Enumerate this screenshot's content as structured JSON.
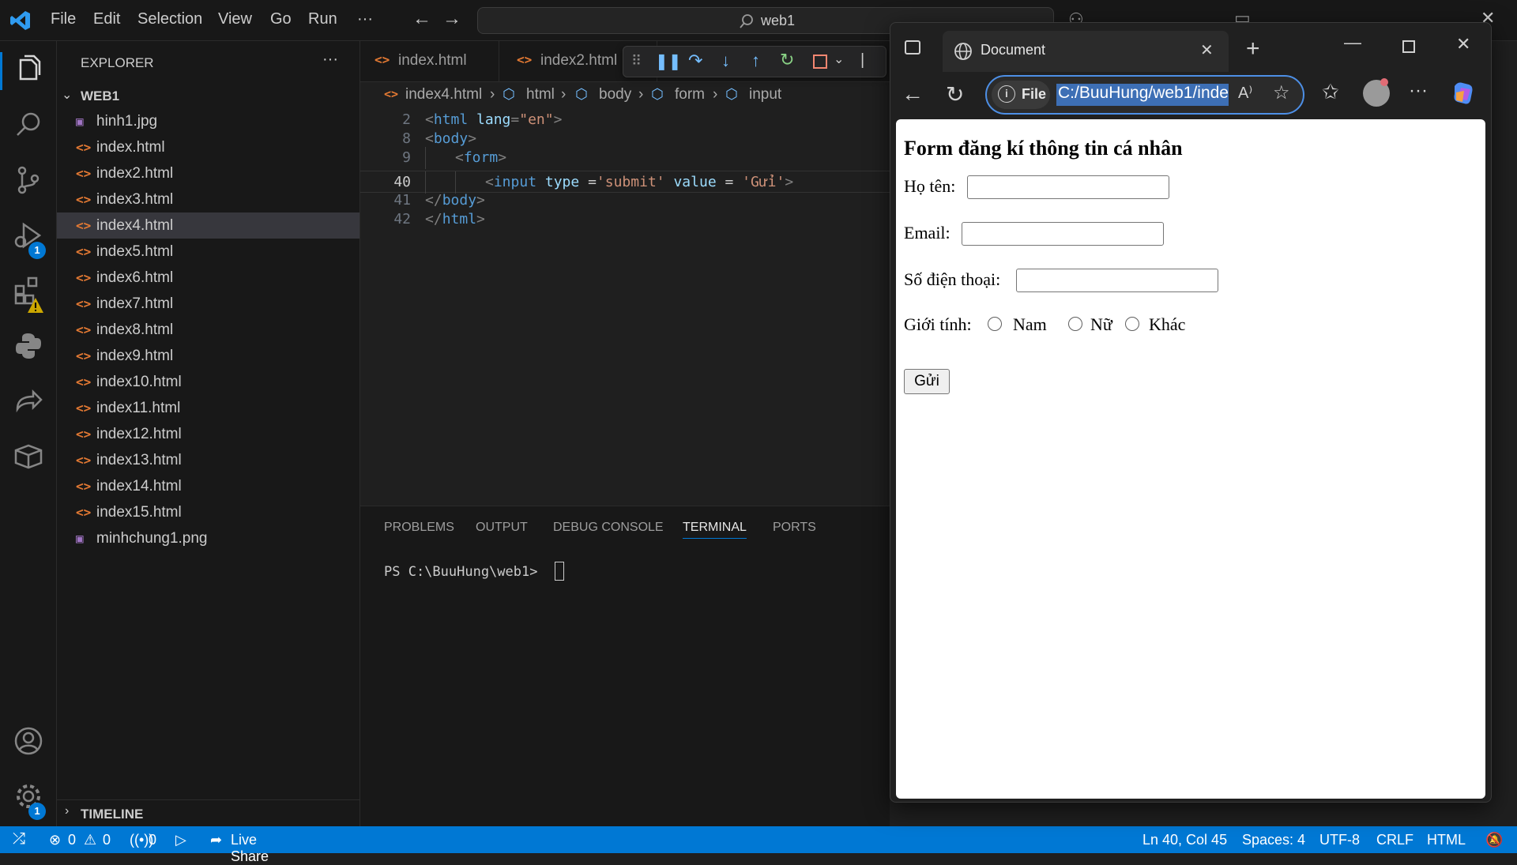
{
  "titlebar": {
    "menu": [
      "File",
      "Edit",
      "Selection",
      "View",
      "Go",
      "Run"
    ],
    "more": "···",
    "search": "web1"
  },
  "activity": {
    "debug_badge": "1",
    "settings_badge": "1"
  },
  "sidebar": {
    "title": "EXPLORER",
    "more": "···",
    "folder": "WEB1",
    "files": [
      {
        "name": "hinh1.jpg",
        "type": "image"
      },
      {
        "name": "index.html",
        "type": "html"
      },
      {
        "name": "index2.html",
        "type": "html"
      },
      {
        "name": "index3.html",
        "type": "html"
      },
      {
        "name": "index4.html",
        "type": "html"
      },
      {
        "name": "index5.html",
        "type": "html"
      },
      {
        "name": "index6.html",
        "type": "html"
      },
      {
        "name": "index7.html",
        "type": "html"
      },
      {
        "name": "index8.html",
        "type": "html"
      },
      {
        "name": "index9.html",
        "type": "html"
      },
      {
        "name": "index10.html",
        "type": "html"
      },
      {
        "name": "index11.html",
        "type": "html"
      },
      {
        "name": "index12.html",
        "type": "html"
      },
      {
        "name": "index13.html",
        "type": "html"
      },
      {
        "name": "index14.html",
        "type": "html"
      },
      {
        "name": "index15.html",
        "type": "html"
      },
      {
        "name": "minhchung1.png",
        "type": "image"
      }
    ],
    "timeline": "TIMELINE"
  },
  "editor": {
    "tabs": [
      "index.html",
      "index2.html"
    ],
    "breadcrumb": [
      "index4.html",
      "html",
      "body",
      "form",
      "input"
    ],
    "lines": [
      {
        "num": "2",
        "indent": 0,
        "parts": [
          [
            "punc",
            "<"
          ],
          [
            "tag",
            "html"
          ],
          [
            "plain",
            " "
          ],
          [
            "attr",
            "lang"
          ],
          [
            "punc",
            "="
          ],
          [
            "str",
            "\"en\""
          ],
          [
            "punc",
            ">"
          ]
        ]
      },
      {
        "num": "8",
        "indent": 0,
        "parts": [
          [
            "punc",
            "<"
          ],
          [
            "tag",
            "body"
          ],
          [
            "punc",
            ">"
          ]
        ]
      },
      {
        "num": "9",
        "indent": 1,
        "parts": [
          [
            "punc",
            "<"
          ],
          [
            "tag",
            "form"
          ],
          [
            "punc",
            ">"
          ]
        ]
      },
      {
        "num": "40",
        "indent": 2,
        "parts": [
          [
            "punc",
            "<"
          ],
          [
            "tag",
            "input"
          ],
          [
            "plain",
            " "
          ],
          [
            "attr",
            "type"
          ],
          [
            "plain",
            " ="
          ],
          [
            "str",
            "'submit'"
          ],
          [
            "plain",
            " "
          ],
          [
            "attr",
            "value"
          ],
          [
            "plain",
            " = "
          ],
          [
            "str",
            "'Gửi'"
          ],
          [
            "punc",
            ">"
          ]
        ]
      },
      {
        "num": "41",
        "indent": 0,
        "parts": [
          [
            "punc",
            "</"
          ],
          [
            "tag",
            "body"
          ],
          [
            "punc",
            ">"
          ]
        ]
      },
      {
        "num": "42",
        "indent": 0,
        "parts": [
          [
            "punc",
            "</"
          ],
          [
            "tag",
            "html"
          ],
          [
            "punc",
            ">"
          ]
        ]
      }
    ],
    "current_line": "40"
  },
  "panel": {
    "tabs": [
      "PROBLEMS",
      "OUTPUT",
      "DEBUG CONSOLE",
      "TERMINAL",
      "PORTS"
    ],
    "active_tab": "TERMINAL",
    "prompt": "PS C:\\BuuHung\\web1>"
  },
  "statusbar": {
    "errors": "0",
    "warnings": "0",
    "ports": "0",
    "live_share": "Live Share",
    "position": "Ln 40, Col 45",
    "spaces": "Spaces: 4",
    "encoding": "UTF-8",
    "eol": "CRLF",
    "language": "HTML"
  },
  "browser": {
    "tab_title": "Document",
    "file_chip": "File",
    "url": "C:/BuuHung/web1/inde",
    "page": {
      "heading": "Form đăng kí thông tin cá nhân",
      "name_label": "Họ tên:",
      "email_label": "Email:",
      "phone_label": "Số điện thoại:",
      "gender_label": "Giới tính:",
      "gender_options": [
        "Nam",
        "Nữ",
        "Khác"
      ],
      "submit": "Gửi"
    }
  },
  "colors": {
    "accent": "#0078d4",
    "html_icon": "#e37933",
    "image_icon": "#a074c4",
    "address_border": "#4d8fe6"
  }
}
